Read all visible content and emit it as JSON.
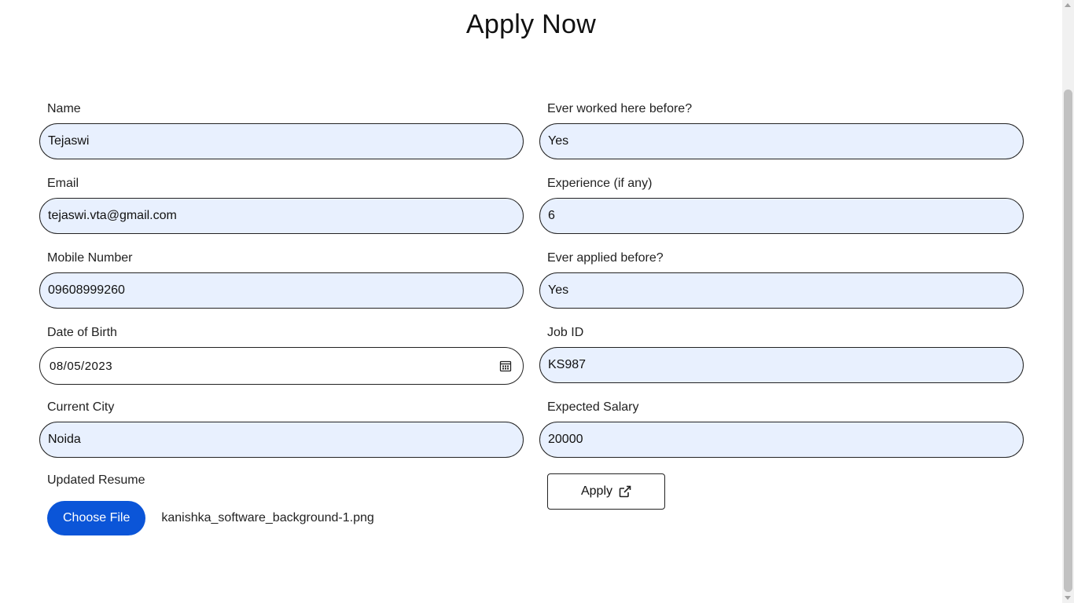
{
  "page": {
    "title": "Apply Now"
  },
  "form": {
    "left": {
      "name": {
        "label": "Name",
        "value": "Tejaswi"
      },
      "email": {
        "label": "Email",
        "value": "tejaswi.vta@gmail.com"
      },
      "mobile": {
        "label": "Mobile Number",
        "value": "09608999260"
      },
      "dob": {
        "label": "Date of Birth",
        "value": "08/05/2023"
      },
      "city": {
        "label": "Current City",
        "value": "Noida"
      },
      "resume": {
        "label": "Updated Resume",
        "button_label": "Choose File",
        "file_name": "kanishka_software_background-1.png"
      }
    },
    "right": {
      "worked_before": {
        "label": "Ever worked here before?",
        "value": "Yes"
      },
      "experience": {
        "label": "Experience (if any)",
        "value": "6"
      },
      "applied_before": {
        "label": "Ever applied before?",
        "value": "Yes"
      },
      "job_id": {
        "label": "Job ID",
        "value": "KS987"
      },
      "salary": {
        "label": "Expected Salary",
        "value": "20000"
      }
    },
    "apply_button": {
      "label": "Apply",
      "icon": "external-link-icon"
    }
  },
  "colors": {
    "input_background": "#e8f0fe",
    "primary_button": "#0b55d8"
  }
}
